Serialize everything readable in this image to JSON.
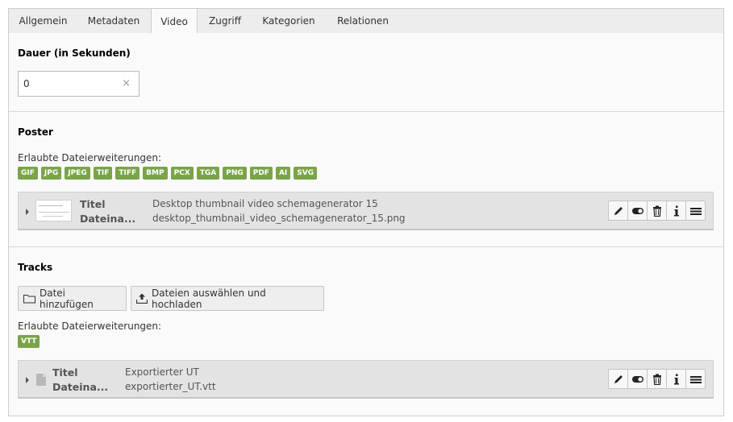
{
  "tabs": [
    {
      "label": "Allgemein"
    },
    {
      "label": "Metadaten"
    },
    {
      "label": "Video"
    },
    {
      "label": "Zugriff"
    },
    {
      "label": "Kategorien"
    },
    {
      "label": "Relationen"
    }
  ],
  "active_tab": "Video",
  "duration": {
    "label": "Dauer (in Sekunden)",
    "value": "0",
    "clear_icon": "×"
  },
  "poster": {
    "heading": "Poster",
    "allowed_label": "Erlaubte Dateierweiterungen:",
    "extensions": [
      "GIF",
      "JPG",
      "JPEG",
      "TIF",
      "TIFF",
      "BMP",
      "PCX",
      "TGA",
      "PNG",
      "PDF",
      "AI",
      "SVG"
    ],
    "file": {
      "title_label": "Titel",
      "filename_label": "Dateina...",
      "title_value": "Desktop thumbnail video schemagenerator 15",
      "filename_value": "desktop_thumbnail_video_schemagenerator_15.png"
    }
  },
  "tracks": {
    "heading": "Tracks",
    "add_file_label": "Datei hinzufügen",
    "upload_label": "Dateien auswählen und hochladen",
    "allowed_label": "Erlaubte Dateierweiterungen:",
    "extensions": [
      "VTT"
    ],
    "file": {
      "title_label": "Titel",
      "filename_label": "Dateina...",
      "title_value": "Exportierter UT",
      "filename_value": "exportierter_UT.vtt"
    }
  },
  "row_actions": [
    "edit-icon",
    "toggle-icon",
    "trash-icon",
    "info-icon",
    "menu-icon"
  ],
  "colors": {
    "badge": "#79a548",
    "tab_bar": "#ededed",
    "panel": "#fafafa"
  }
}
